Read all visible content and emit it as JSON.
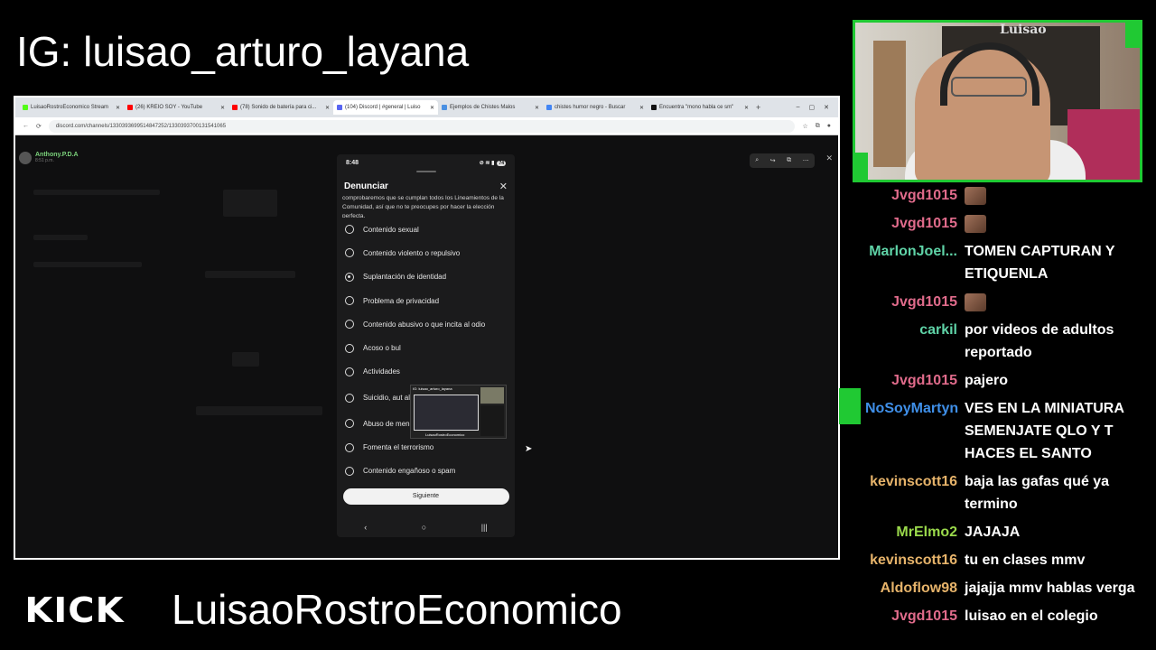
{
  "overlay": {
    "ig_handle": "IG: luisao_arturo_layana",
    "platform_logo": "KICK",
    "channel_name": "LuisaoRostroEconomico",
    "accent_color": "#20c933"
  },
  "browser": {
    "tabs": [
      {
        "label": "LuisaoRostroEconomico Stream",
        "fav_color": "#53fc18"
      },
      {
        "label": "(26) KREIO SOY - YouTube",
        "fav_color": "#ff0000"
      },
      {
        "label": "(78) Sonido de batería para ci...",
        "fav_color": "#ff0000"
      },
      {
        "label": "(104) Discord | #general | Luiso",
        "fav_color": "#5865f2"
      },
      {
        "label": "Ejemplos de Chistes Malos",
        "fav_color": "#4a90e2"
      },
      {
        "label": "chistes humor negro - Buscar",
        "fav_color": "#4285f4"
      },
      {
        "label": "Encuentra \"mono habla ce sm\"",
        "fav_color": "#111111"
      }
    ],
    "url": "discord.com/channels/1330393699514847252/1330393700131541065"
  },
  "discord": {
    "username": "Anthony.P.D.A",
    "time": "8:51 p.m."
  },
  "phone": {
    "time": "8:48",
    "battery": "74",
    "sheet_title": "Denunciar",
    "intro": "comprobaremos que se cumplan todos los Lineamientos de la Comunidad, así que no te preocupes por hacer la elección perfecta.",
    "options": [
      {
        "label": "Contenido sexual",
        "selected": false
      },
      {
        "label": "Contenido violento o repulsivo",
        "selected": false
      },
      {
        "label": "Suplantación de identidad",
        "selected": true
      },
      {
        "label": "Problema de privacidad",
        "selected": false
      },
      {
        "label": "Contenido abusivo o que incita al odio",
        "selected": false
      },
      {
        "label": "Acoso o bul",
        "selected": false
      },
      {
        "label": "Actividades",
        "selected": false
      },
      {
        "label": "Suicidio, aut alimentarios",
        "selected": false
      },
      {
        "label": "Abuso de menores",
        "selected": false
      },
      {
        "label": "Fomenta el terrorismo",
        "selected": false
      },
      {
        "label": "Contenido engañoso o spam",
        "selected": false
      }
    ],
    "next_label": "Siguiente",
    "mini_preview_title": "IG: luisao_arturo_layana",
    "mini_preview_channel": "LuisaoRostroEconomico"
  },
  "webcam": {
    "poster_text": "Luisao"
  },
  "chat": [
    {
      "author": "Jvgd1015",
      "color": "#e06b8b",
      "text": "",
      "emote": true
    },
    {
      "author": "Jvgd1015",
      "color": "#e06b8b",
      "text": "",
      "emote": true
    },
    {
      "author": "MarlonJoel...",
      "color": "#5fd3a7",
      "text": "TOMEN CAPTURAN Y ETIQUENLA",
      "emote": false
    },
    {
      "author": "Jvgd1015",
      "color": "#e06b8b",
      "text": "",
      "emote": true
    },
    {
      "author": "carkil",
      "color": "#5fd3a7",
      "text": "por videos de adultos reportado",
      "emote": false
    },
    {
      "author": "Jvgd1015",
      "color": "#e06b8b",
      "text": "pajero",
      "emote": false
    },
    {
      "author": "NoSoyMartyn",
      "color": "#3f8fe8",
      "text": "VES EN LA MINIATURA SEMENJATE QLO Y T HACES EL SANTO",
      "emote": false
    },
    {
      "author": "kevinscott16",
      "color": "#e6b36a",
      "text": "baja las gafas qué ya termino",
      "emote": false
    },
    {
      "author": "MrElmo2",
      "color": "#9ad94b",
      "text": "JAJAJA",
      "emote": false
    },
    {
      "author": "kevinscott16",
      "color": "#e6b36a",
      "text": "tu en clases mmv",
      "emote": false
    },
    {
      "author": "Aldoflow98",
      "color": "#e6b36a",
      "text": "jajajja mmv hablas verga",
      "emote": false
    },
    {
      "author": "Jvgd1015",
      "color": "#e06b8b",
      "text": "luisao en el colegio",
      "emote": false
    }
  ]
}
